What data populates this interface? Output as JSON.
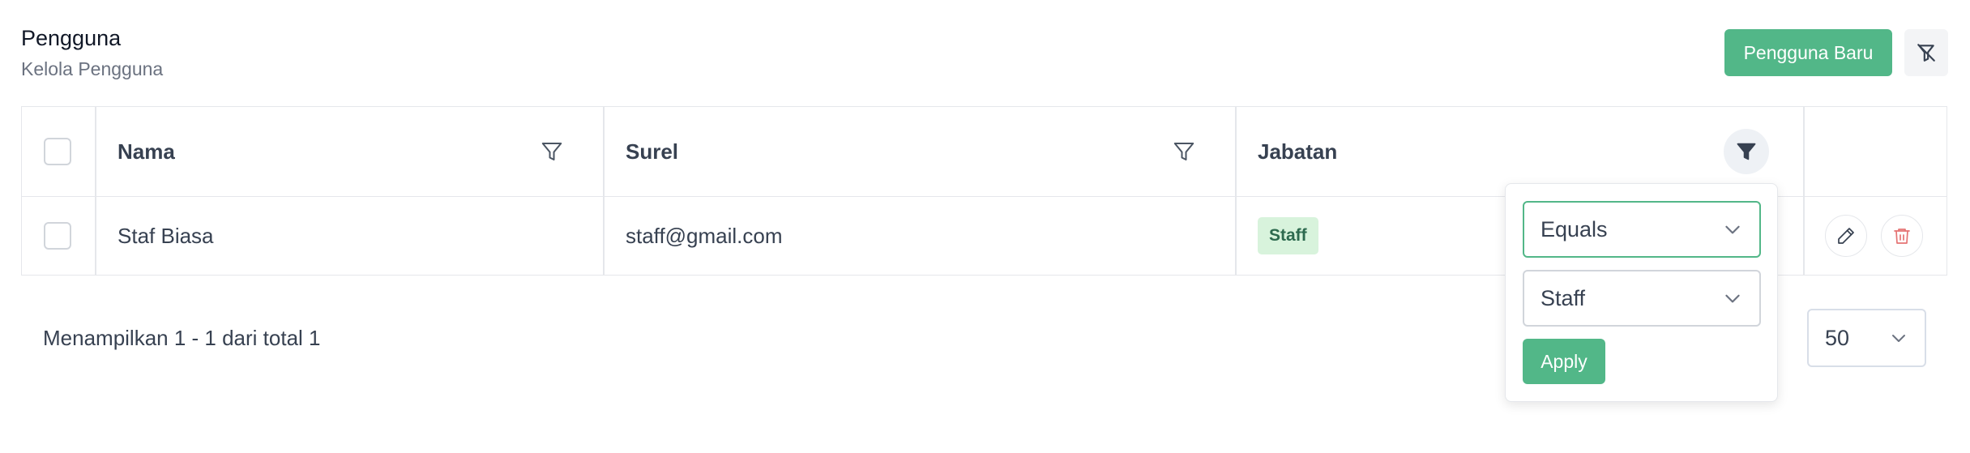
{
  "header": {
    "title": "Pengguna",
    "subtitle": "Kelola Pengguna",
    "new_button_label": "Pengguna Baru"
  },
  "table": {
    "columns": [
      {
        "label": "Nama"
      },
      {
        "label": "Surel"
      },
      {
        "label": "Jabatan"
      }
    ],
    "rows": [
      {
        "name": "Staf Biasa",
        "email": "staff@gmail.com",
        "role": "Staff"
      }
    ]
  },
  "pagination": {
    "summary": "Menampilkan 1 - 1 dari total 1",
    "page_size": "50"
  },
  "filter_popover": {
    "operator": "Equals",
    "value": "Staff",
    "apply_label": "Apply"
  },
  "colors": {
    "primary": "#52b788",
    "badge_bg": "#d8f3dc",
    "badge_text": "#2d6a4f",
    "delete": "#e57373"
  },
  "icons": {
    "clear_filter": "filter-off-icon",
    "column_filter": "filter-icon",
    "edit": "pencil-icon",
    "delete": "trash-icon",
    "dropdown": "chevron-down-icon"
  }
}
